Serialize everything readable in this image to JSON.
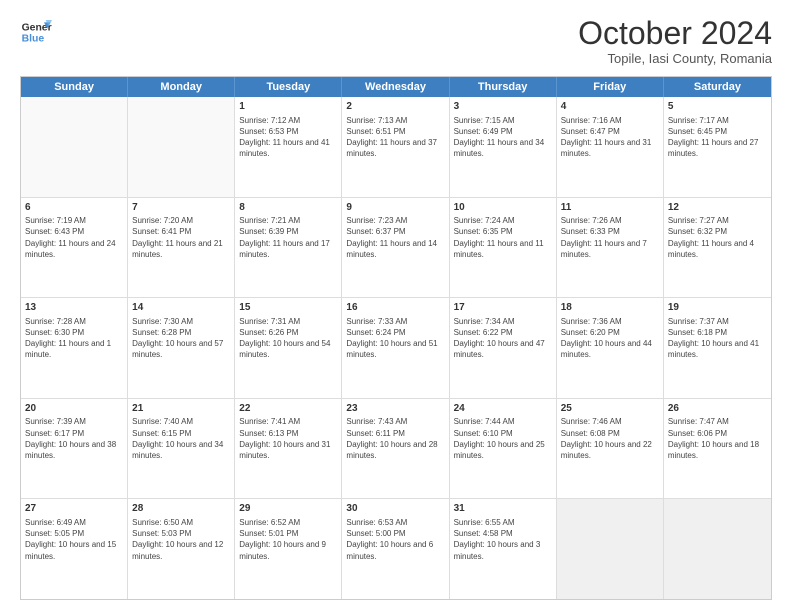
{
  "logo": {
    "line1": "General",
    "line2": "Blue"
  },
  "title": "October 2024",
  "subtitle": "Topile, Iasi County, Romania",
  "days": [
    "Sunday",
    "Monday",
    "Tuesday",
    "Wednesday",
    "Thursday",
    "Friday",
    "Saturday"
  ],
  "rows": [
    [
      {
        "day": "",
        "text": "",
        "empty": true
      },
      {
        "day": "",
        "text": "",
        "empty": true
      },
      {
        "day": "1",
        "text": "Sunrise: 7:12 AM\nSunset: 6:53 PM\nDaylight: 11 hours and 41 minutes."
      },
      {
        "day": "2",
        "text": "Sunrise: 7:13 AM\nSunset: 6:51 PM\nDaylight: 11 hours and 37 minutes."
      },
      {
        "day": "3",
        "text": "Sunrise: 7:15 AM\nSunset: 6:49 PM\nDaylight: 11 hours and 34 minutes."
      },
      {
        "day": "4",
        "text": "Sunrise: 7:16 AM\nSunset: 6:47 PM\nDaylight: 11 hours and 31 minutes."
      },
      {
        "day": "5",
        "text": "Sunrise: 7:17 AM\nSunset: 6:45 PM\nDaylight: 11 hours and 27 minutes."
      }
    ],
    [
      {
        "day": "6",
        "text": "Sunrise: 7:19 AM\nSunset: 6:43 PM\nDaylight: 11 hours and 24 minutes."
      },
      {
        "day": "7",
        "text": "Sunrise: 7:20 AM\nSunset: 6:41 PM\nDaylight: 11 hours and 21 minutes."
      },
      {
        "day": "8",
        "text": "Sunrise: 7:21 AM\nSunset: 6:39 PM\nDaylight: 11 hours and 17 minutes."
      },
      {
        "day": "9",
        "text": "Sunrise: 7:23 AM\nSunset: 6:37 PM\nDaylight: 11 hours and 14 minutes."
      },
      {
        "day": "10",
        "text": "Sunrise: 7:24 AM\nSunset: 6:35 PM\nDaylight: 11 hours and 11 minutes."
      },
      {
        "day": "11",
        "text": "Sunrise: 7:26 AM\nSunset: 6:33 PM\nDaylight: 11 hours and 7 minutes."
      },
      {
        "day": "12",
        "text": "Sunrise: 7:27 AM\nSunset: 6:32 PM\nDaylight: 11 hours and 4 minutes."
      }
    ],
    [
      {
        "day": "13",
        "text": "Sunrise: 7:28 AM\nSunset: 6:30 PM\nDaylight: 11 hours and 1 minute."
      },
      {
        "day": "14",
        "text": "Sunrise: 7:30 AM\nSunset: 6:28 PM\nDaylight: 10 hours and 57 minutes."
      },
      {
        "day": "15",
        "text": "Sunrise: 7:31 AM\nSunset: 6:26 PM\nDaylight: 10 hours and 54 minutes."
      },
      {
        "day": "16",
        "text": "Sunrise: 7:33 AM\nSunset: 6:24 PM\nDaylight: 10 hours and 51 minutes."
      },
      {
        "day": "17",
        "text": "Sunrise: 7:34 AM\nSunset: 6:22 PM\nDaylight: 10 hours and 47 minutes."
      },
      {
        "day": "18",
        "text": "Sunrise: 7:36 AM\nSunset: 6:20 PM\nDaylight: 10 hours and 44 minutes."
      },
      {
        "day": "19",
        "text": "Sunrise: 7:37 AM\nSunset: 6:18 PM\nDaylight: 10 hours and 41 minutes."
      }
    ],
    [
      {
        "day": "20",
        "text": "Sunrise: 7:39 AM\nSunset: 6:17 PM\nDaylight: 10 hours and 38 minutes."
      },
      {
        "day": "21",
        "text": "Sunrise: 7:40 AM\nSunset: 6:15 PM\nDaylight: 10 hours and 34 minutes."
      },
      {
        "day": "22",
        "text": "Sunrise: 7:41 AM\nSunset: 6:13 PM\nDaylight: 10 hours and 31 minutes."
      },
      {
        "day": "23",
        "text": "Sunrise: 7:43 AM\nSunset: 6:11 PM\nDaylight: 10 hours and 28 minutes."
      },
      {
        "day": "24",
        "text": "Sunrise: 7:44 AM\nSunset: 6:10 PM\nDaylight: 10 hours and 25 minutes."
      },
      {
        "day": "25",
        "text": "Sunrise: 7:46 AM\nSunset: 6:08 PM\nDaylight: 10 hours and 22 minutes."
      },
      {
        "day": "26",
        "text": "Sunrise: 7:47 AM\nSunset: 6:06 PM\nDaylight: 10 hours and 18 minutes."
      }
    ],
    [
      {
        "day": "27",
        "text": "Sunrise: 6:49 AM\nSunset: 5:05 PM\nDaylight: 10 hours and 15 minutes."
      },
      {
        "day": "28",
        "text": "Sunrise: 6:50 AM\nSunset: 5:03 PM\nDaylight: 10 hours and 12 minutes."
      },
      {
        "day": "29",
        "text": "Sunrise: 6:52 AM\nSunset: 5:01 PM\nDaylight: 10 hours and 9 minutes."
      },
      {
        "day": "30",
        "text": "Sunrise: 6:53 AM\nSunset: 5:00 PM\nDaylight: 10 hours and 6 minutes."
      },
      {
        "day": "31",
        "text": "Sunrise: 6:55 AM\nSunset: 4:58 PM\nDaylight: 10 hours and 3 minutes."
      },
      {
        "day": "",
        "text": "",
        "empty": true,
        "shaded": true
      },
      {
        "day": "",
        "text": "",
        "empty": true,
        "shaded": true
      }
    ]
  ]
}
